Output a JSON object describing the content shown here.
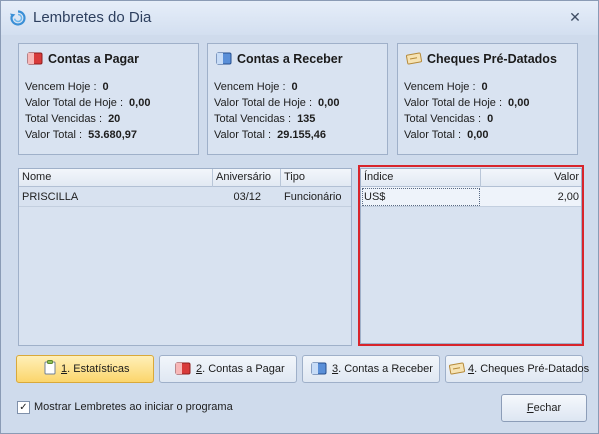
{
  "window": {
    "title": "Lembretes do Dia",
    "close_glyph": "✕",
    "icon": "refresh-icon"
  },
  "panels": {
    "pagar": {
      "title": "Contas a Pagar",
      "icon": "red-card-icon",
      "rows": [
        {
          "label": "Vencem Hoje :",
          "value": "0"
        },
        {
          "label": "Valor Total de Hoje :",
          "value": "0,00"
        },
        {
          "label": "Total Vencidas :",
          "value": "20"
        },
        {
          "label": "Valor Total :",
          "value": "53.680,97"
        }
      ]
    },
    "receber": {
      "title": "Contas a Receber",
      "icon": "blue-card-icon",
      "rows": [
        {
          "label": "Vencem Hoje :",
          "value": "0"
        },
        {
          "label": "Valor Total de Hoje :",
          "value": "0,00"
        },
        {
          "label": "Total Vencidas :",
          "value": "135"
        },
        {
          "label": "Valor Total :",
          "value": "29.155,46"
        }
      ]
    },
    "cheques": {
      "title": "Cheques Pré-Datados",
      "icon": "cheque-icon",
      "rows": [
        {
          "label": "Vencem Hoje :",
          "value": "0"
        },
        {
          "label": "Valor Total de Hoje :",
          "value": "0,00"
        },
        {
          "label": "Total Vencidas :",
          "value": "0"
        },
        {
          "label": "Valor Total :",
          "value": "0,00"
        }
      ]
    }
  },
  "birthdays": {
    "columns": [
      "Nome",
      "Aniversário",
      "Tipo"
    ],
    "rows": [
      {
        "nome": "PRISCILLA",
        "aniversario": "03/12",
        "tipo": "Funcionário"
      }
    ]
  },
  "indices": {
    "columns": [
      "Índice",
      "Valor"
    ],
    "rows": [
      {
        "indice": "US$",
        "valor": "2,00"
      }
    ]
  },
  "tabs": [
    {
      "key": "1",
      "label": ". Estatísticas",
      "icon": "clipboard-icon",
      "active": true
    },
    {
      "key": "2",
      "label": ". Contas a Pagar",
      "icon": "red-card-icon",
      "active": false
    },
    {
      "key": "3",
      "label": ". Contas a Receber",
      "icon": "blue-card-icon",
      "active": false
    },
    {
      "key": "4",
      "label": ". Cheques Pré-Datados",
      "icon": "cheque-icon",
      "active": false
    }
  ],
  "footer": {
    "checkbox_label": "Mostrar Lembretes ao iniciar o programa",
    "checkbox_checked": true,
    "check_glyph": "✓",
    "close_key": "F",
    "close_rest": "echar"
  },
  "colors": {
    "window_bg": "#cfdbec",
    "highlight_border": "#d8242b",
    "active_tab": "#fbd56c"
  }
}
